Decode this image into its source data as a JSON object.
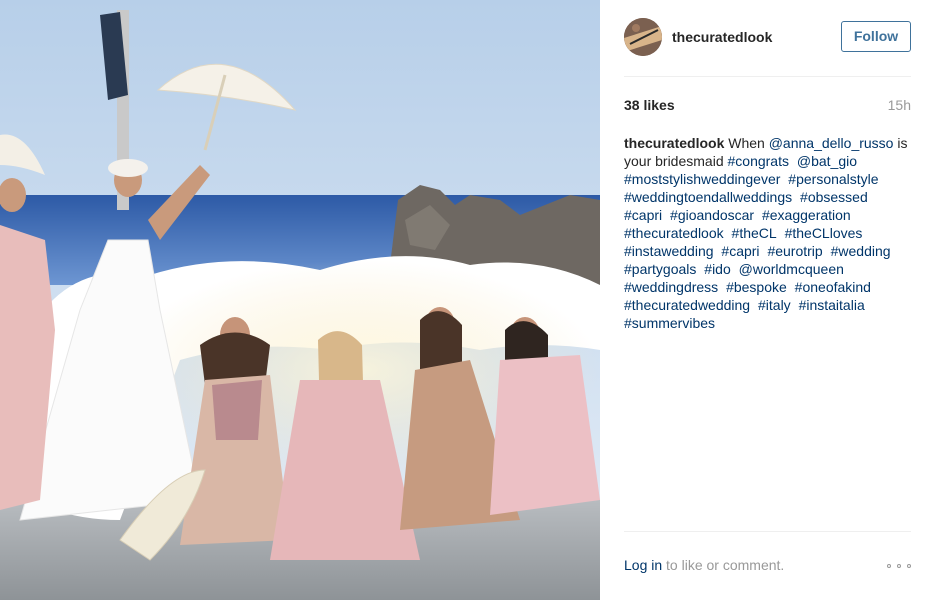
{
  "post": {
    "image_alt": "Bride in white gown with bridesmaids in pink dresses by the sea in Capri"
  },
  "header": {
    "username": "thecuratedlook",
    "follow_label": "Follow"
  },
  "meta": {
    "likes": "38 likes",
    "time_ago": "15h"
  },
  "caption": {
    "username": "thecuratedlook",
    "text_1": " When ",
    "mention_1": "@anna_dello_russo",
    "text_2": " is your bridesmaid ",
    "tags_1": [
      "#congrats"
    ],
    "mention_2": "@bat_gio",
    "tags_2": [
      "#moststylishweddingever",
      "#personalstyle",
      "#weddingtoendallweddings",
      "#obsessed",
      "#capri",
      "#gioandoscar",
      "#exaggeration",
      "#thecuratedlook",
      "#theCL",
      "#theCLloves",
      "#instawedding",
      "#capri",
      "#eurotrip",
      "#wedding",
      "#partygoals",
      "#ido"
    ],
    "mention_3": "@worldmcqueen",
    "tags_3": [
      "#weddingdress",
      "#bespoke",
      "#oneofakind",
      "#thecuratedwedding",
      "#italy",
      "#instaitalia",
      "#summervibes"
    ]
  },
  "footer": {
    "login_label": "Log in",
    "login_suffix": " to like or comment.",
    "more_icon": "more-options-icon"
  },
  "colors": {
    "link": "#003569",
    "follow": "#3f729b",
    "muted": "#999999",
    "divider": "#efefef"
  }
}
